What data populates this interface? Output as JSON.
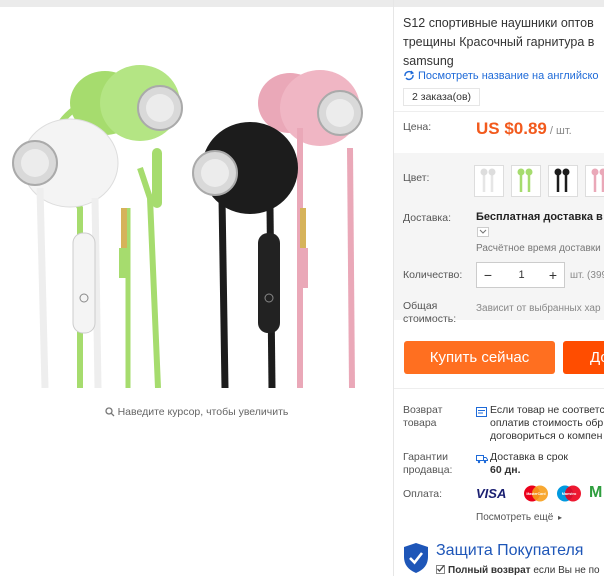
{
  "product": {
    "title_lines": [
      "S12 спортивные наушники оптов",
      "трещины Красочный гарнитура в",
      "samsung"
    ],
    "translate_link": "Посмотреть название на английско",
    "orders": "2 заказа(ов)",
    "zoom_hint": "Наведите курсор, чтобы увеличить"
  },
  "price": {
    "label": "Цена:",
    "value": "US $0.89",
    "unit": "/ шт."
  },
  "color": {
    "label": "Цвет:",
    "options": [
      "white",
      "green",
      "black",
      "pink"
    ]
  },
  "shipping": {
    "label": "Доставка:",
    "title": "Бесплатная доставка в Ru",
    "time": "Расчётное время доставки"
  },
  "quantity": {
    "label": "Количество:",
    "minus": "−",
    "value": "1",
    "plus": "+",
    "unit": "шт. (399"
  },
  "total": {
    "label_line1": "Общая",
    "label_line2": "стоимость:",
    "text": "Зависит от выбранных хар"
  },
  "buttons": {
    "buy": "Купить сейчас",
    "cart": "До"
  },
  "returns": {
    "label_line1": "Возврат",
    "label_line2": "товара",
    "lines": [
      "Если товар не соответс",
      "оплатив стоимость обр",
      "договориться о компен"
    ]
  },
  "guarantee": {
    "label_line1": "Гарантии",
    "label_line2": "продавца:",
    "line1": "Доставка в срок",
    "line2": "60 дн."
  },
  "payment": {
    "label": "Оплата:",
    "visa": "VISA",
    "mc1": "MasterCard",
    "mc2": "Maestro",
    "more": "Посмотреть ещё"
  },
  "protection": {
    "title": "Защита Покупателя",
    "bold": "Полный возврат",
    "rest": " если Вы не по"
  },
  "colors": {
    "accent": "#ff6f20",
    "price": "#f25a1d",
    "link": "#1e6ad8",
    "earphone_green": "#a6dc6e",
    "earphone_pink": "#eaa8b8",
    "earphone_black": "#1c1c1c",
    "earphone_white": "#f2f2f2"
  }
}
